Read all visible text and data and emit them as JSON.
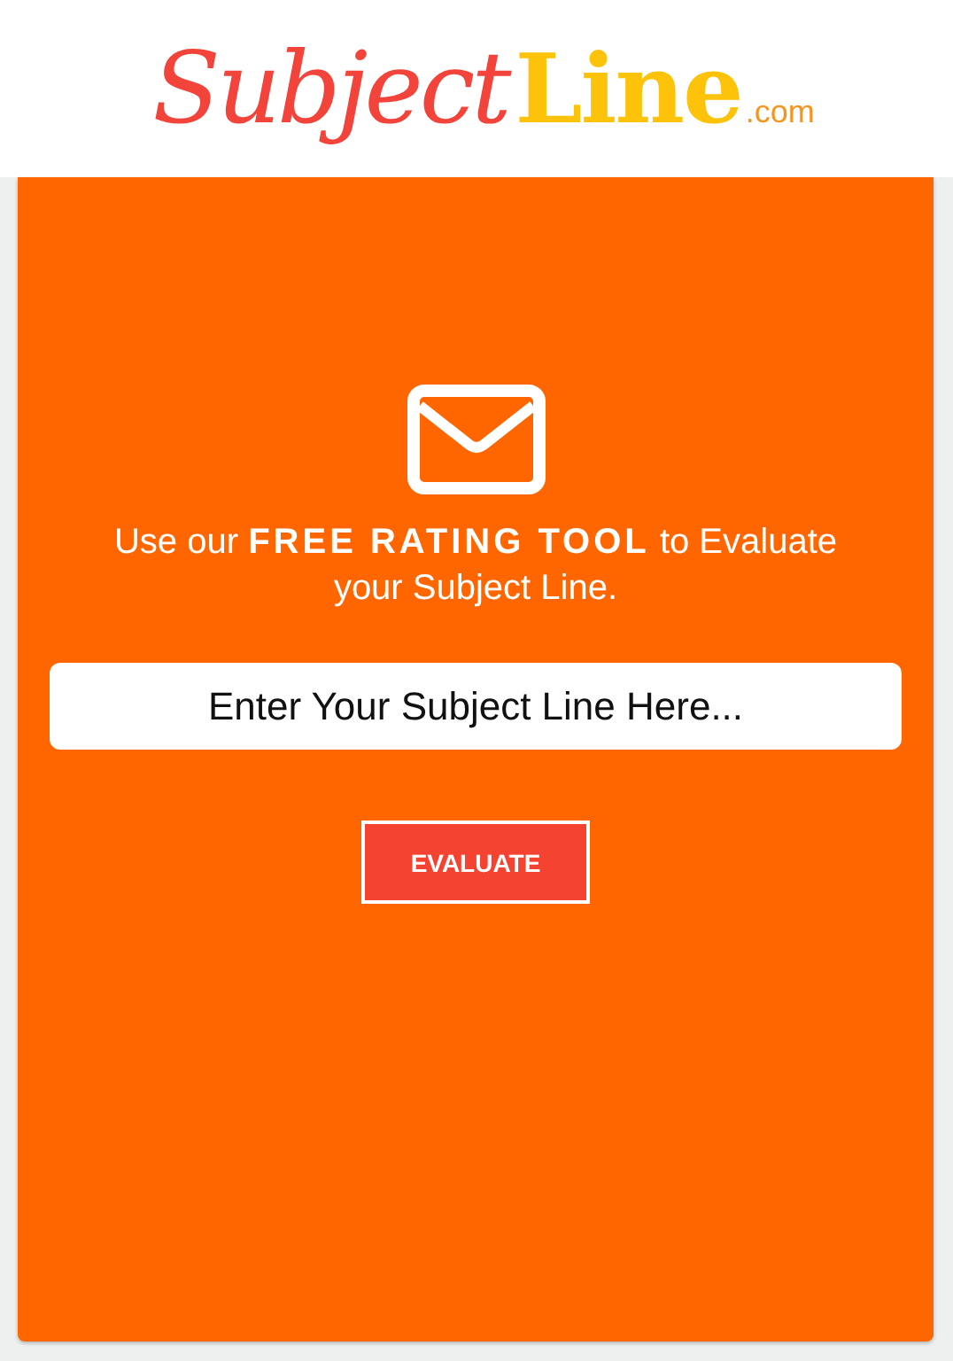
{
  "logo": {
    "first": "Subject",
    "second": "Line",
    "suffix": ".com"
  },
  "hero": {
    "message": "Use our **FREE RATING TOOL** to Evaluate your Subject Line.",
    "field": {
      "placeholder": "Enter Your Subject Line Here..."
    },
    "button": "EVALUATE"
  }
}
